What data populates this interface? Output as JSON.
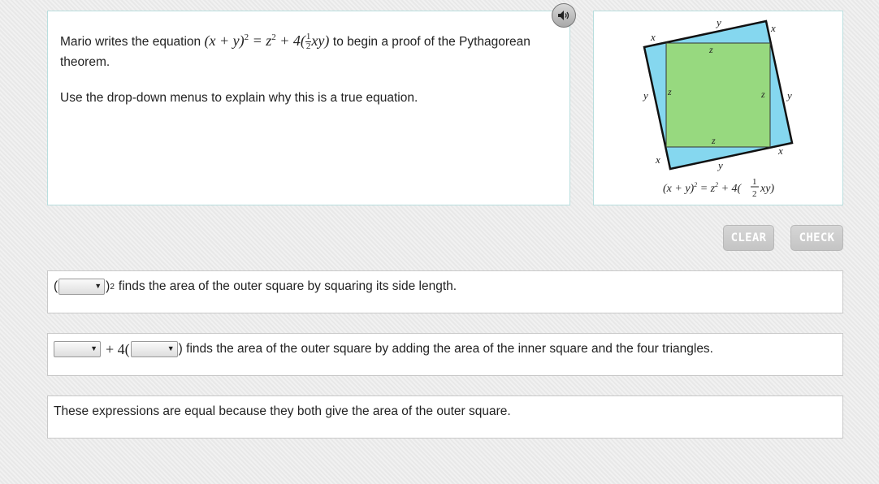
{
  "question": {
    "intro_before": "Mario writes the equation",
    "equation": {
      "lhs_open": "(x + y)",
      "lhs_exp": "2",
      "rhs_a": "= z",
      "rhs_a_exp": "2",
      "rhs_b": " + 4(",
      "frac_num": "1",
      "frac_den": "2",
      "rhs_c": "xy)"
    },
    "intro_after": "to begin a proof of the Pythagorean theorem.",
    "instruction": "Use the drop-down menus to explain why this is a true equation."
  },
  "figure": {
    "label_x": "x",
    "label_y": "y",
    "label_z": "z",
    "caption_lhs": "(x + y)",
    "caption_exp": "2",
    "caption_mid": " = z",
    "caption_mid_exp": "2",
    "caption_plus": " + 4(",
    "caption_frac_num": "1",
    "caption_frac_den": "2",
    "caption_end": "xy)",
    "colors": {
      "outer": "#85d7ef",
      "inner": "#97d97f",
      "stroke": "#111111"
    }
  },
  "buttons": {
    "clear": "CLEAR",
    "check": "CHECK"
  },
  "rows": {
    "row1": {
      "open_paren": "(",
      "close_paren": ")",
      "exp": "2",
      "text": "finds the area of the outer square by squaring its side length."
    },
    "row2": {
      "plus_four": "+ 4(",
      "close_paren": ")",
      "text": "finds the area of the outer square by adding the area of the inner square and the four triangles."
    },
    "row3": {
      "text": "These expressions are equal because they both give the area of the outer square."
    }
  },
  "dropdowns": {
    "dropdown_1": "",
    "dropdown_2": "",
    "dropdown_3": ""
  },
  "icons": {
    "audio": "speaker-icon",
    "dropdown_arrow": "triangle-down-icon"
  }
}
